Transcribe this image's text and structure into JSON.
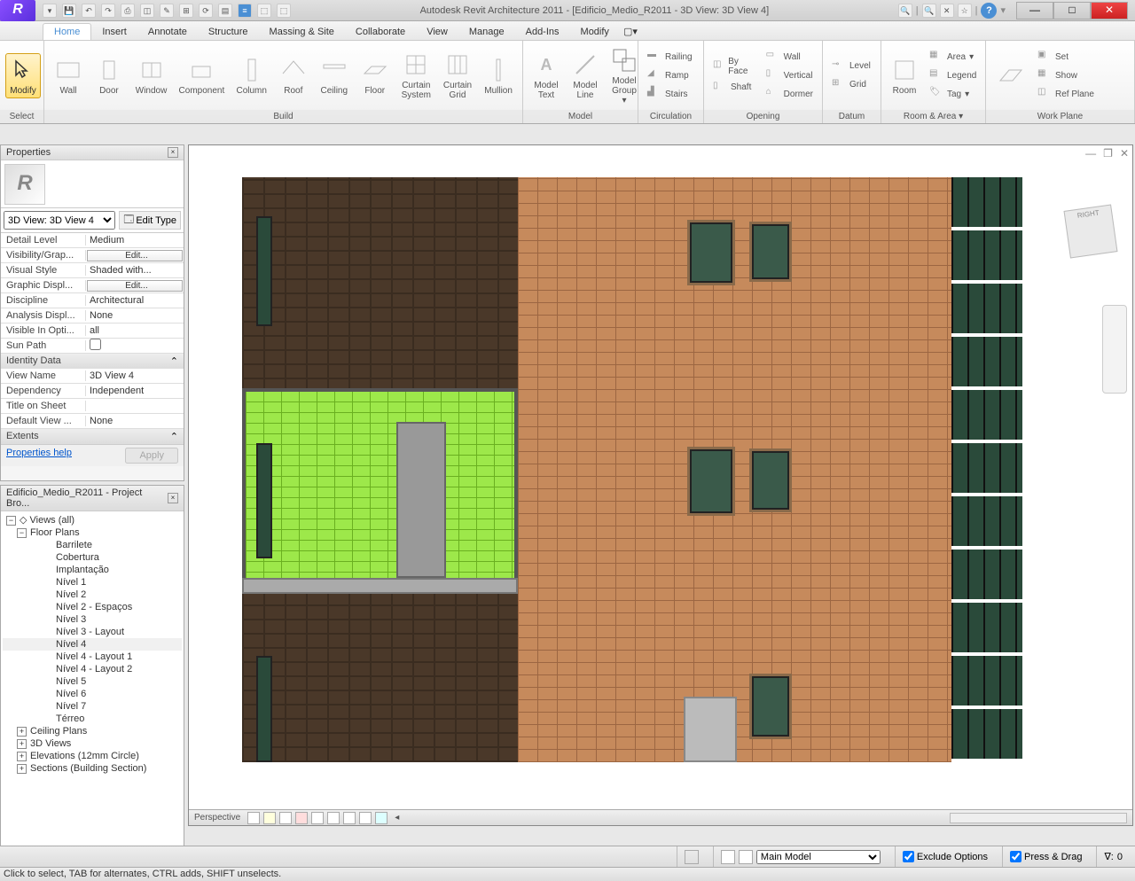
{
  "titlebar": {
    "title": "Autodesk Revit Architecture 2011 - [Edificio_Medio_R2011 - 3D View: 3D View 4]"
  },
  "tabs": [
    "Home",
    "Insert",
    "Annotate",
    "Structure",
    "Massing & Site",
    "Collaborate",
    "View",
    "Manage",
    "Add-Ins",
    "Modify"
  ],
  "active_tab": "Home",
  "ribbon": {
    "select": {
      "modify": "Modify",
      "label": "Select"
    },
    "build": {
      "label": "Build",
      "items": [
        "Wall",
        "Door",
        "Window",
        "Component",
        "Column",
        "Roof",
        "Ceiling",
        "Floor",
        "Curtain System",
        "Curtain Grid",
        "Mullion"
      ]
    },
    "model": {
      "label": "Model",
      "items": [
        "Model Text",
        "Model Line",
        "Model Group"
      ]
    },
    "circulation": {
      "label": "Circulation",
      "items": [
        "Railing",
        "Ramp",
        "Stairs"
      ]
    },
    "opening": {
      "label": "Opening",
      "items": [
        "By Face",
        "Shaft",
        "Wall",
        "Vertical",
        "Dormer"
      ]
    },
    "datum": {
      "label": "Datum",
      "items": [
        "Level",
        "Grid"
      ]
    },
    "roomarea": {
      "label": "Room & Area",
      "room": "Room",
      "items": [
        "Area",
        "Legend",
        "Tag"
      ]
    },
    "workplane": {
      "label": "Work Plane",
      "items": [
        "Set",
        "Show",
        "Ref Plane"
      ]
    }
  },
  "properties": {
    "title": "Properties",
    "type_selector": "3D View: 3D View 4",
    "edit_type": "Edit Type",
    "rows": [
      {
        "k": "Detail Level",
        "v": "Medium"
      },
      {
        "k": "Visibility/Grap...",
        "v": "Edit...",
        "btn": true
      },
      {
        "k": "Visual Style",
        "v": "Shaded with..."
      },
      {
        "k": "Graphic Displ...",
        "v": "Edit...",
        "btn": true
      },
      {
        "k": "Discipline",
        "v": "Architectural"
      },
      {
        "k": "Analysis Displ...",
        "v": "None"
      },
      {
        "k": "Visible In Opti...",
        "v": "all"
      },
      {
        "k": "Sun Path",
        "v": "",
        "chk": true
      }
    ],
    "identity_label": "Identity Data",
    "identity_rows": [
      {
        "k": "View Name",
        "v": "3D View 4"
      },
      {
        "k": "Dependency",
        "v": "Independent"
      },
      {
        "k": "Title on Sheet",
        "v": ""
      },
      {
        "k": "Default View ...",
        "v": "None"
      }
    ],
    "extents_label": "Extents",
    "help_link": "Properties help",
    "apply": "Apply"
  },
  "browser": {
    "title": "Edificio_Medio_R2011 - Project Bro...",
    "root": "Views (all)",
    "floor_plans": "Floor Plans",
    "floor_plan_items": [
      "Barrilete",
      "Cobertura",
      "Implantação",
      "Nível 1",
      "Nível 2",
      "Nível 2 - Espaços",
      "Nível 3",
      "Nível 3 - Layout",
      "Nível 4",
      "Nível 4 - Layout 1",
      "Nível 4 - Layout 2",
      "Nível 5",
      "Nível 6",
      "Nível 7",
      "Térreo"
    ],
    "selected_item": "Nível 4",
    "other_groups": [
      "Ceiling Plans",
      "3D Views",
      "Elevations (12mm Circle)",
      "Sections (Building Section)"
    ]
  },
  "view": {
    "mode": "Perspective",
    "viewcube": "RIGHT"
  },
  "statusbar": {
    "main_model": "Main Model",
    "exclude": "Exclude Options",
    "pressdrag": "Press & Drag",
    "filter": "0",
    "hint": "Click to select, TAB for alternates, CTRL adds, SHIFT unselects."
  }
}
